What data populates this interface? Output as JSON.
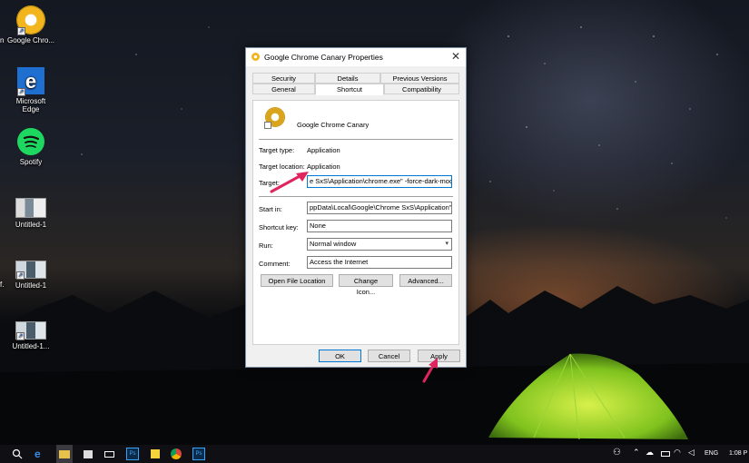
{
  "desktop": {
    "icons": [
      {
        "label": "Google Chro...",
        "icon": "chrome-canary-icon"
      },
      {
        "label": "Microsoft Edge",
        "icon": "edge-icon"
      },
      {
        "label": "Spotify",
        "icon": "spotify-icon"
      },
      {
        "label": "Untitled-1",
        "icon": "image-file-icon"
      },
      {
        "label": "Untitled-1",
        "icon": "image-file-icon"
      },
      {
        "label": "Untitled-1...",
        "icon": "image-file-icon"
      }
    ],
    "left_clips": [
      "n",
      "f."
    ]
  },
  "dialog": {
    "title": "Google Chrome Canary Properties",
    "close_label": "✕",
    "tabs_top": [
      "Security",
      "Details",
      "Previous Versions"
    ],
    "tabs_bottom": [
      "General",
      "Shortcut",
      "Compatibility"
    ],
    "active_tab": "Shortcut",
    "app_name": "Google Chrome Canary",
    "target_type_label": "Target type:",
    "target_type_value": "Application",
    "target_location_label": "Target location:",
    "target_location_value": "Application",
    "target_label": "Target:",
    "target_value": "e SxS\\Application\\chrome.exe\" -force-dark-mode",
    "start_in_label": "Start in:",
    "start_in_value": "ppData\\Local\\Google\\Chrome SxS\\Application\"",
    "shortcut_key_label": "Shortcut key:",
    "shortcut_key_value": "None",
    "run_label": "Run:",
    "run_value": "Normal window",
    "comment_label": "Comment:",
    "comment_value": "Access the Internet",
    "open_file_location": "Open File Location",
    "change_icon": "Change Icon...",
    "advanced": "Advanced...",
    "ok": "OK",
    "cancel": "Cancel",
    "apply": "Apply"
  },
  "taskbar": {
    "language": "ENG",
    "time": "1:08 P"
  },
  "colors": {
    "annotation_arrow": "#e0245e",
    "focus_border": "#0078d7"
  }
}
